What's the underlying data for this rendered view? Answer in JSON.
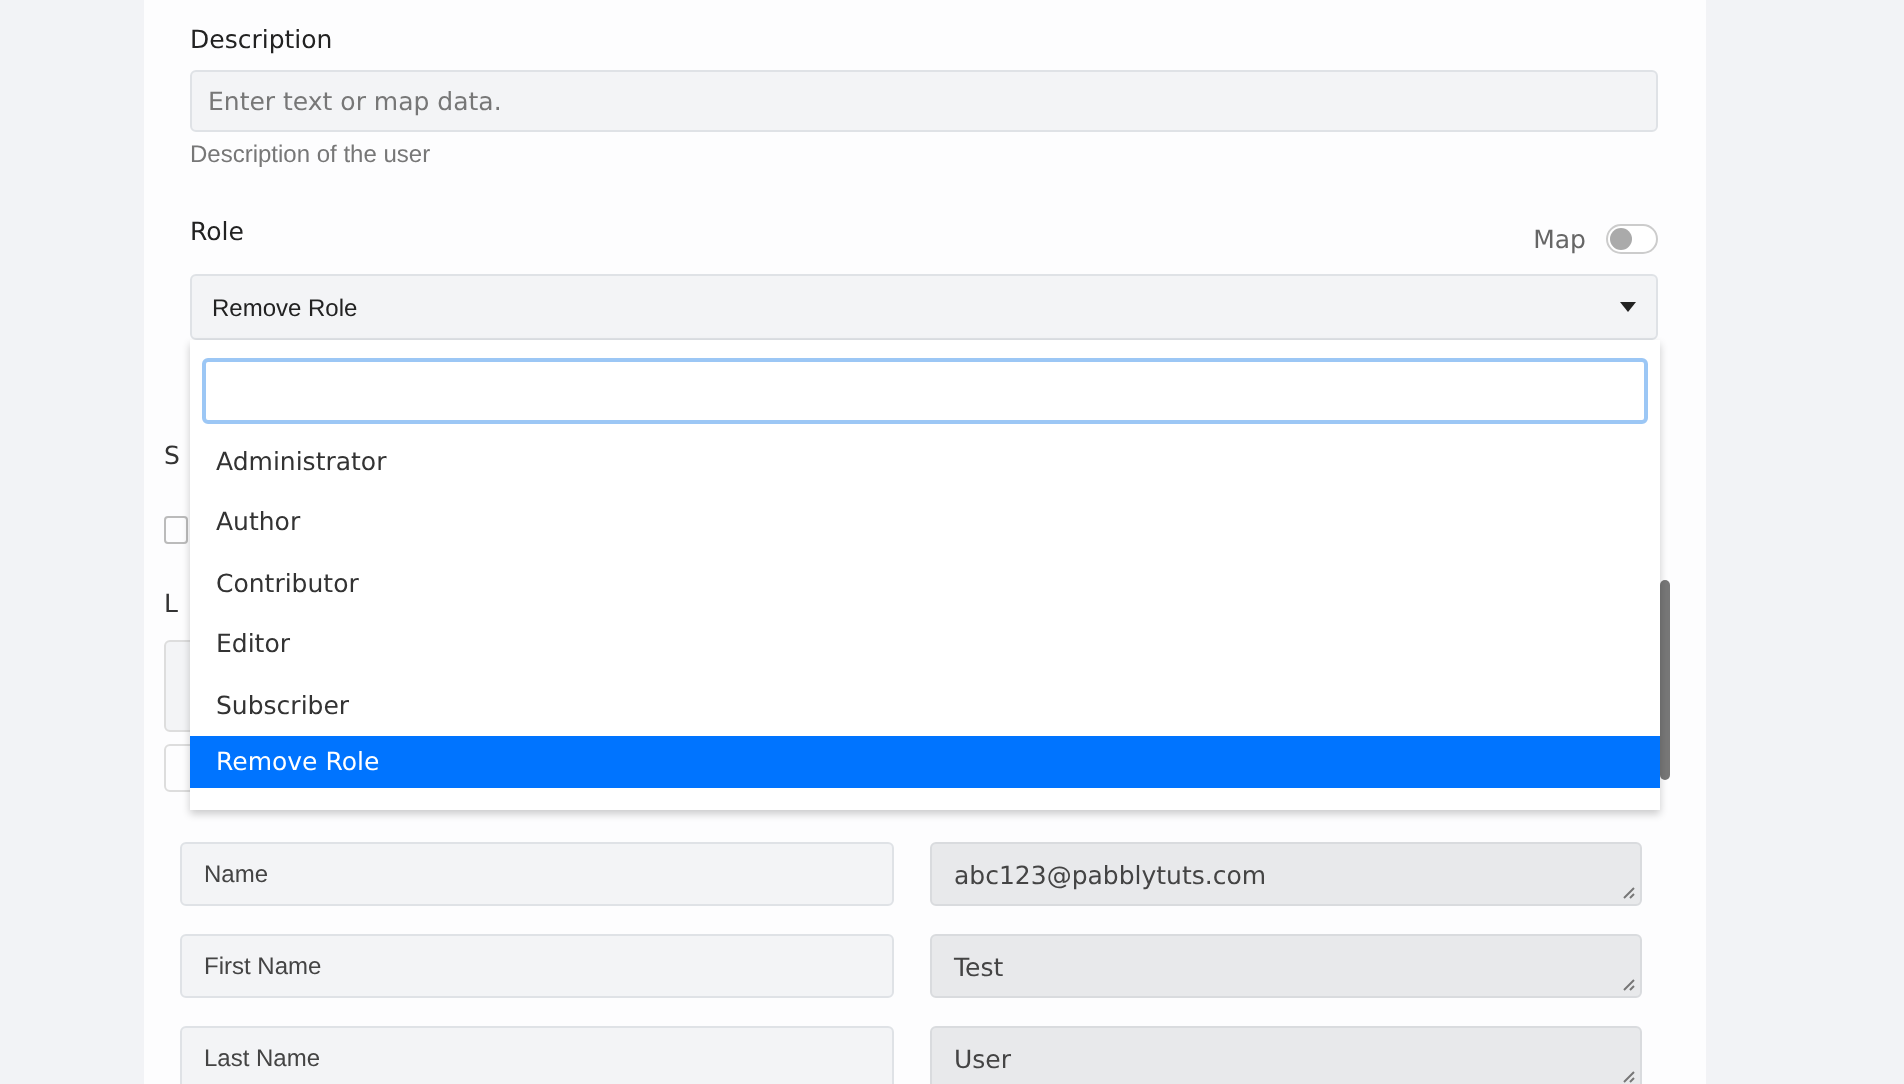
{
  "description": {
    "label": "Description",
    "placeholder": "Enter text or map data.",
    "help": "Description of the user"
  },
  "role": {
    "label": "Role",
    "map_label": "Map",
    "map_on": false,
    "value": "Remove Role",
    "options": [
      {
        "label": "Administrator",
        "selected": false
      },
      {
        "label": "Author",
        "selected": false
      },
      {
        "label": "Contributor",
        "selected": false
      },
      {
        "label": "Editor",
        "selected": false
      },
      {
        "label": "Subscriber",
        "selected": false
      },
      {
        "label": "Remove Role",
        "selected": true
      }
    ]
  },
  "covered_labels": [
    "S",
    "L"
  ],
  "covered_checkbox": {
    "checked": false
  },
  "mappings": [
    {
      "field": "Name",
      "value": "abc123@pabblytuts.com"
    },
    {
      "field": "First Name",
      "value": "Test"
    },
    {
      "field": "Last Name",
      "value": "User"
    }
  ]
}
